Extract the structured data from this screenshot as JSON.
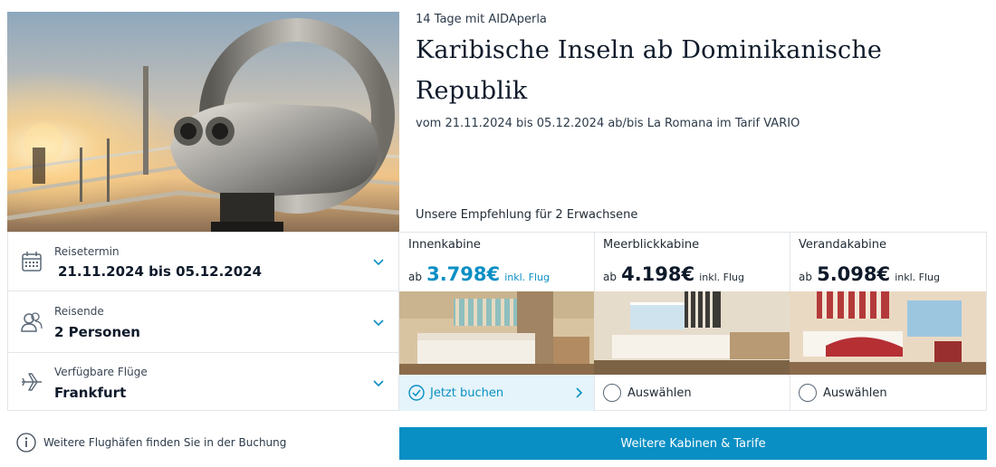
{
  "trip": {
    "subline": "14 Tage mit AIDAperla",
    "title": "Karibische Inseln ab Dominikanische Republik",
    "dates_line": "vom 21.11.2024 bis 05.12.2024 ab/bis La Romana im Tarif VARIO",
    "recommendation": "Unsere Empfehlung für 2 Erwachsene"
  },
  "selectors": [
    {
      "label": "Reisetermin",
      "value": "21.11.2024 bis 05.12.2024",
      "icon": "calendar-icon"
    },
    {
      "label": "Reisende",
      "value": "2 Personen",
      "icon": "people-icon"
    },
    {
      "label": "Verfügbare Flüge",
      "value": "Frankfurt",
      "icon": "airplane-icon"
    }
  ],
  "cabins": [
    {
      "name": "Innenkabine",
      "price_prefix": "ab",
      "price": "3.798€",
      "price_suffix": "inkl. Flug",
      "action": "Jetzt buchen",
      "selected": true
    },
    {
      "name": "Meerblickkabine",
      "price_prefix": "ab",
      "price": "4.198€",
      "price_suffix": "inkl. Flug",
      "action": "Auswählen",
      "selected": false
    },
    {
      "name": "Verandakabine",
      "price_prefix": "ab",
      "price": "5.098€",
      "price_suffix": "inkl. Flug",
      "action": "Auswählen",
      "selected": false
    }
  ],
  "footer": {
    "info_text": "Weitere Flughäfen finden Sie in der Buchung",
    "more_button": "Weitere Kabinen & Tarife"
  },
  "colors": {
    "accent": "#0a8fc4",
    "selected_bg": "#e5f4fa"
  }
}
